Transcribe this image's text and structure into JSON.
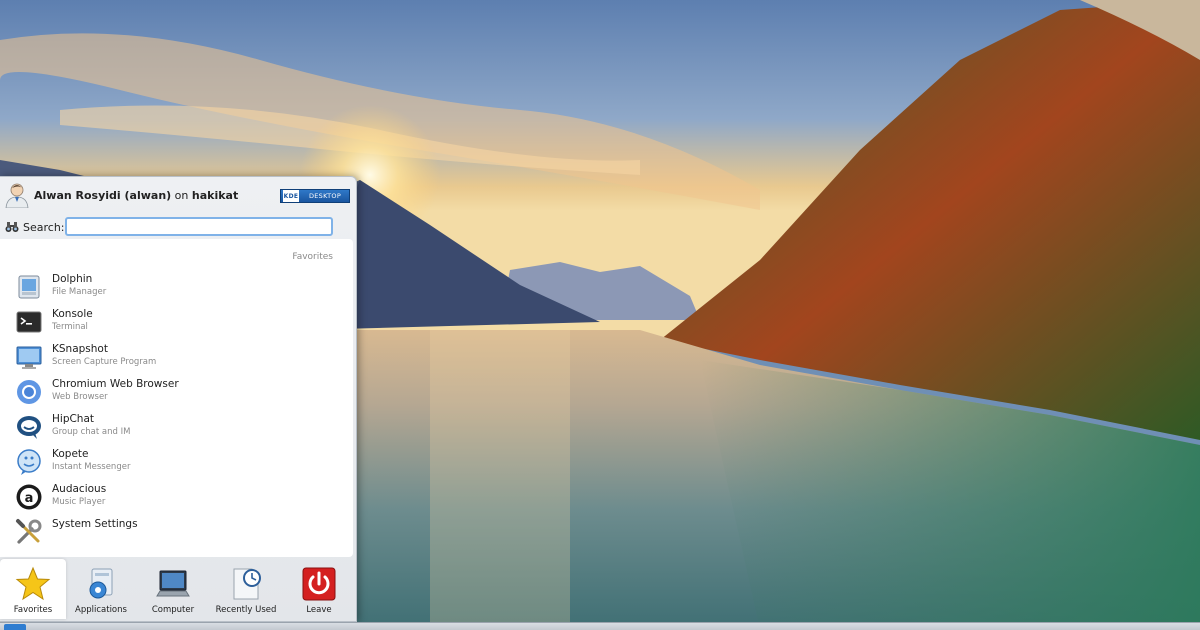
{
  "menu": {
    "user_name": "Alwan Rosyidi (alwan)",
    "on_word": " on ",
    "host": "hakikat",
    "badge_logo": "KDE",
    "badge_text": "DESKTOP",
    "search_label": "Search:",
    "search_value": "",
    "section_title": "Favorites",
    "favorites": [
      {
        "name": "Dolphin",
        "desc": "File Manager",
        "icon": "folder-icon"
      },
      {
        "name": "Konsole",
        "desc": "Terminal",
        "icon": "terminal-icon"
      },
      {
        "name": "KSnapshot",
        "desc": "Screen Capture Program",
        "icon": "screenshot-icon"
      },
      {
        "name": "Chromium Web Browser",
        "desc": "Web Browser",
        "icon": "chromium-icon"
      },
      {
        "name": "HipChat",
        "desc": "Group chat and IM",
        "icon": "hipchat-icon"
      },
      {
        "name": "Kopete",
        "desc": "Instant Messenger",
        "icon": "kopete-icon"
      },
      {
        "name": "Audacious",
        "desc": "Music Player",
        "icon": "audacious-icon"
      },
      {
        "name": "System Settings",
        "desc": "",
        "icon": "settings-icon"
      }
    ],
    "tabs": [
      {
        "label": "Favorites",
        "icon": "star-icon",
        "active": true
      },
      {
        "label": "Applications",
        "icon": "applications-icon",
        "active": false
      },
      {
        "label": "Computer",
        "icon": "computer-icon",
        "active": false
      },
      {
        "label": "Recently Used",
        "icon": "clock-icon",
        "active": false
      },
      {
        "label": "Leave",
        "icon": "power-icon",
        "active": false
      }
    ]
  },
  "colors": {
    "accent": "#2f78c8",
    "leave_red": "#d42020"
  }
}
